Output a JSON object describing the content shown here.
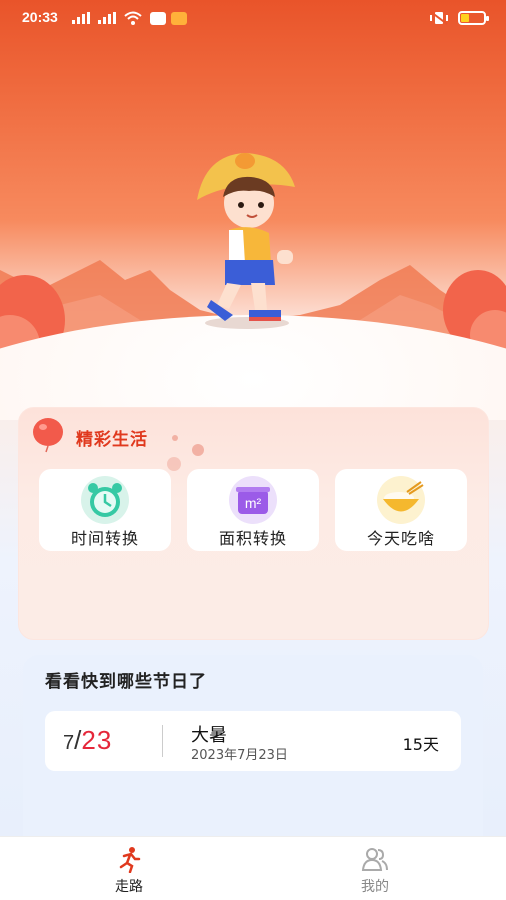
{
  "status_bar": {
    "time": "20:33"
  },
  "life": {
    "title": "精彩生活",
    "tools": [
      {
        "label": "时间转换",
        "icon": "alarm-clock-icon"
      },
      {
        "label": "面积转换",
        "icon": "square-meter-icon"
      },
      {
        "label": "今天吃啥",
        "icon": "rice-bowl-icon"
      }
    ]
  },
  "festivals": {
    "title": "看看快到哪些节日了",
    "items": [
      {
        "month": "7",
        "day": "23",
        "name": "大暑",
        "date_full": "2023年7月23日",
        "remaining": "15天"
      }
    ]
  },
  "tabbar": {
    "items": [
      {
        "label": "走路",
        "icon": "runner-icon",
        "active": true
      },
      {
        "label": "我的",
        "icon": "users-icon",
        "active": false
      }
    ]
  },
  "colors": {
    "accent": "#e0391e",
    "date_day": "#e5273a",
    "hero_top": "#e9542a"
  }
}
